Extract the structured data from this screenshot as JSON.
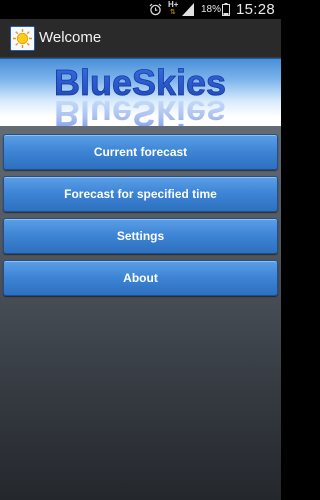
{
  "status_bar": {
    "network": "H+",
    "battery_percent": "18%",
    "time": "15:28"
  },
  "action_bar": {
    "title": "Welcome",
    "app_icon": "sun-icon"
  },
  "banner": {
    "logo_text": "BlueSkies"
  },
  "menu": {
    "items": [
      {
        "label": "Current forecast"
      },
      {
        "label": "Forecast for specified time"
      },
      {
        "label": "Settings"
      },
      {
        "label": "About"
      }
    ]
  },
  "colors": {
    "button": "#3f86d6",
    "logo": "#2f5fd6",
    "action_bar": "#2a2a2a"
  }
}
